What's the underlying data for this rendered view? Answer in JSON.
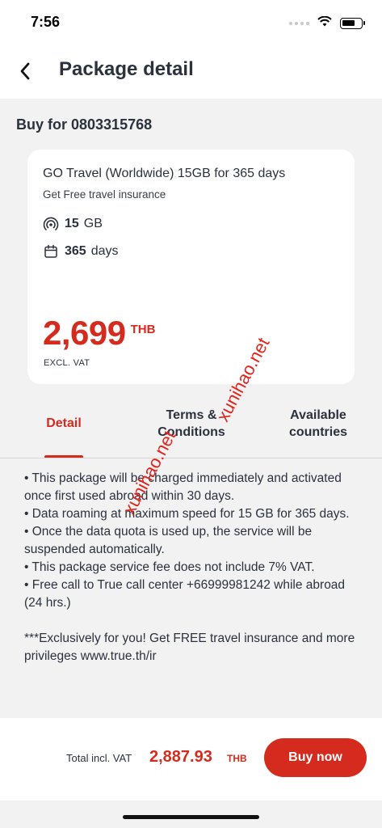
{
  "status_bar": {
    "time": "7:56",
    "battery_level_pct": 70
  },
  "header": {
    "title": "Package detail",
    "back_icon": "chevron-left-icon"
  },
  "buy_for": "Buy for 0803315768",
  "package": {
    "name": "GO Travel (Worldwide) 15GB for 365 days",
    "subtitle": "Get Free travel insurance",
    "data": {
      "amount": "15",
      "unit": "GB",
      "icon": "data-signal-icon"
    },
    "validity": {
      "amount": "365",
      "unit": "days",
      "icon": "calendar-icon"
    },
    "price": "2,699",
    "currency": "THB",
    "price_note": "EXCL. VAT"
  },
  "tabs": {
    "detail": "Detail",
    "terms": "Terms & Conditions",
    "countries": "Available countries"
  },
  "detail": {
    "lines": [
      "• This package will be charged immediately and activated once first used abroad within 30 days.",
      "• Data roaming at maximum speed for 15 GB for 365 days.",
      "• Once the data quota is used up, the service will be suspended automatically.",
      "• This package service fee does not include 7% VAT.",
      "• Free call to True call center +66999981242 while abroad (24 hrs.)"
    ],
    "note": "***Exclusively for you! Get FREE travel insurance and more privileges www.true.th/ir"
  },
  "footer": {
    "total_label": "Total incl. VAT",
    "total_value": "2,887.93",
    "total_currency": "THB",
    "buy_button": "Buy now"
  },
  "watermark": "xunihao.net",
  "colors": {
    "accent": "#d52b1e",
    "text": "#2b313d",
    "background": "#f2f2f2"
  }
}
